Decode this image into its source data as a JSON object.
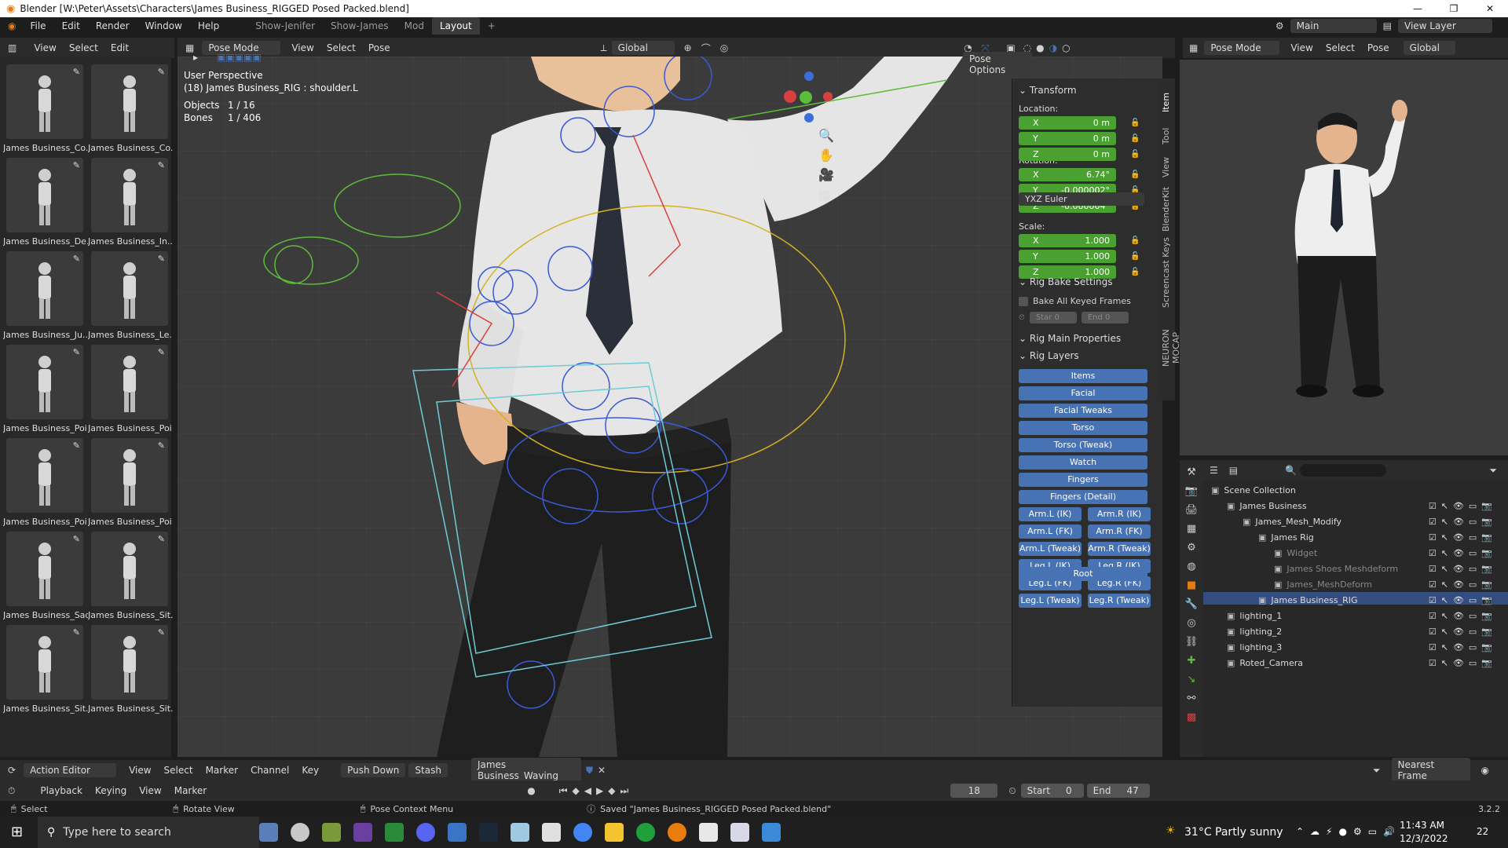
{
  "titlebar": {
    "title": "Blender [W:\\Peter\\Assets\\Characters\\James Business_RIGGED Posed Packed.blend]",
    "minimize": "—",
    "maximize": "❐",
    "close": "✕"
  },
  "menubar": {
    "items": [
      "File",
      "Edit",
      "Render",
      "Window",
      "Help"
    ],
    "workspaces": [
      "Show-Jenifer",
      "Show-James",
      "Mod",
      "Layout"
    ],
    "add_tab": "+",
    "scene": "Main",
    "view_layer": "View Layer"
  },
  "asset_browser": {
    "menu": [
      "View",
      "Select",
      "Edit"
    ],
    "items": [
      "James Business_Co...",
      "James Business_Co...",
      "James Business_De...",
      "James Business_In...",
      "James Business_Ju...",
      "James Business_Le...",
      "James Business_Poi",
      "James Business_Poi",
      "James Business_Poi",
      "James Business_Poi",
      "James Business_Sad",
      "James Business_Sit...",
      "James Business_Sit...",
      "James Business_Sit..."
    ]
  },
  "viewport": {
    "mode": "Pose Mode",
    "menu": [
      "View",
      "Select",
      "Pose"
    ],
    "orientation": "Global",
    "pose_options": "Pose Options",
    "perspective": "User Perspective",
    "active": "(18) James Business_RIG : shoulder.L",
    "objects_label": "Objects",
    "objects_value": "1 / 16",
    "bones_label": "Bones",
    "bones_value": "1 / 406"
  },
  "npanel": {
    "transform": "Transform",
    "location": "Location:",
    "rotation": "Rotation:",
    "scale": "Scale:",
    "loc": [
      {
        "a": "X",
        "v": "0 m"
      },
      {
        "a": "Y",
        "v": "0 m"
      },
      {
        "a": "Z",
        "v": "0 m"
      }
    ],
    "rot": [
      {
        "a": "X",
        "v": "6.74°"
      },
      {
        "a": "Y",
        "v": "-0.000002°"
      },
      {
        "a": "Z",
        "v": "-0.000004°"
      }
    ],
    "scl": [
      {
        "a": "X",
        "v": "1.000"
      },
      {
        "a": "Y",
        "v": "1.000"
      },
      {
        "a": "Z",
        "v": "1.000"
      }
    ],
    "rot_mode": "YXZ Euler",
    "rig_bake": "Rig Bake Settings",
    "bake_all": "Bake All Keyed Frames",
    "start": "Star 0",
    "end": "End 0",
    "rig_main": "Rig Main Properties",
    "rig_layers": "Rig Layers",
    "layers_full": [
      "Items",
      "Facial",
      "Facial Tweaks",
      "Torso",
      "Torso (Tweak)",
      "Watch",
      "Fingers",
      "Fingers (Detail)"
    ],
    "layers_pair": [
      [
        "Arm.L (IK)",
        "Arm.R (IK)"
      ],
      [
        "Arm.L (FK)",
        "Arm.R (FK)"
      ],
      [
        "Arm.L (Tweak)",
        "Arm.R (Tweak)"
      ],
      [
        "Leg.L (IK)",
        "Leg.R (IK)"
      ],
      [
        "Leg.L (FK)",
        "Leg.R (FK)"
      ],
      [
        "Leg.L (Tweak)",
        "Leg.R (Tweak)"
      ]
    ],
    "root": "Root"
  },
  "side_tabs": [
    "Item",
    "Tool",
    "View",
    "BlenderKit",
    "Screencast Keys",
    "NEURON MOCAP"
  ],
  "preview": {
    "mode": "Pose Mode",
    "menu": [
      "View",
      "Select",
      "Pose"
    ],
    "orientation": "Global"
  },
  "outliner": {
    "rows": [
      {
        "t": "Scene Collection",
        "i": 0
      },
      {
        "t": "James Business",
        "i": 1
      },
      {
        "t": "James_Mesh_Modify",
        "i": 2
      },
      {
        "t": "James Rig",
        "i": 3
      },
      {
        "t": "Widget",
        "i": 4
      },
      {
        "t": "James Shoes Meshdeform",
        "i": 4
      },
      {
        "t": "James_MeshDeform",
        "i": 4
      },
      {
        "t": "James Business_RIG",
        "i": 3
      },
      {
        "t": "lighting_1",
        "i": 1
      },
      {
        "t": "lighting_2",
        "i": 1
      },
      {
        "t": "lighting_3",
        "i": 1
      },
      {
        "t": "Roted_Camera",
        "i": 1
      }
    ]
  },
  "action_editor": {
    "mode": "Action Editor",
    "menu": [
      "View",
      "Select",
      "Marker",
      "Channel",
      "Key"
    ],
    "push_down": "Push Down",
    "stash": "Stash",
    "action": "James Business_Waving",
    "snap": "Nearest Frame"
  },
  "timeline": {
    "menu": [
      "Playback",
      "Keying",
      "View",
      "Marker"
    ],
    "frame": "18",
    "start_label": "Start",
    "start": "0",
    "end_label": "End",
    "end": "47"
  },
  "status": {
    "select": "Select",
    "rotate": "Rotate View",
    "context": "Pose Context Menu",
    "saved": "Saved \"James Business_RIGGED Posed Packed.blend\"",
    "version": "3.2.2"
  },
  "taskbar": {
    "search": "Type here to search",
    "weather": "31°C  Partly sunny",
    "time": "11:43 AM",
    "date": "12/3/2022",
    "notif": "22"
  }
}
